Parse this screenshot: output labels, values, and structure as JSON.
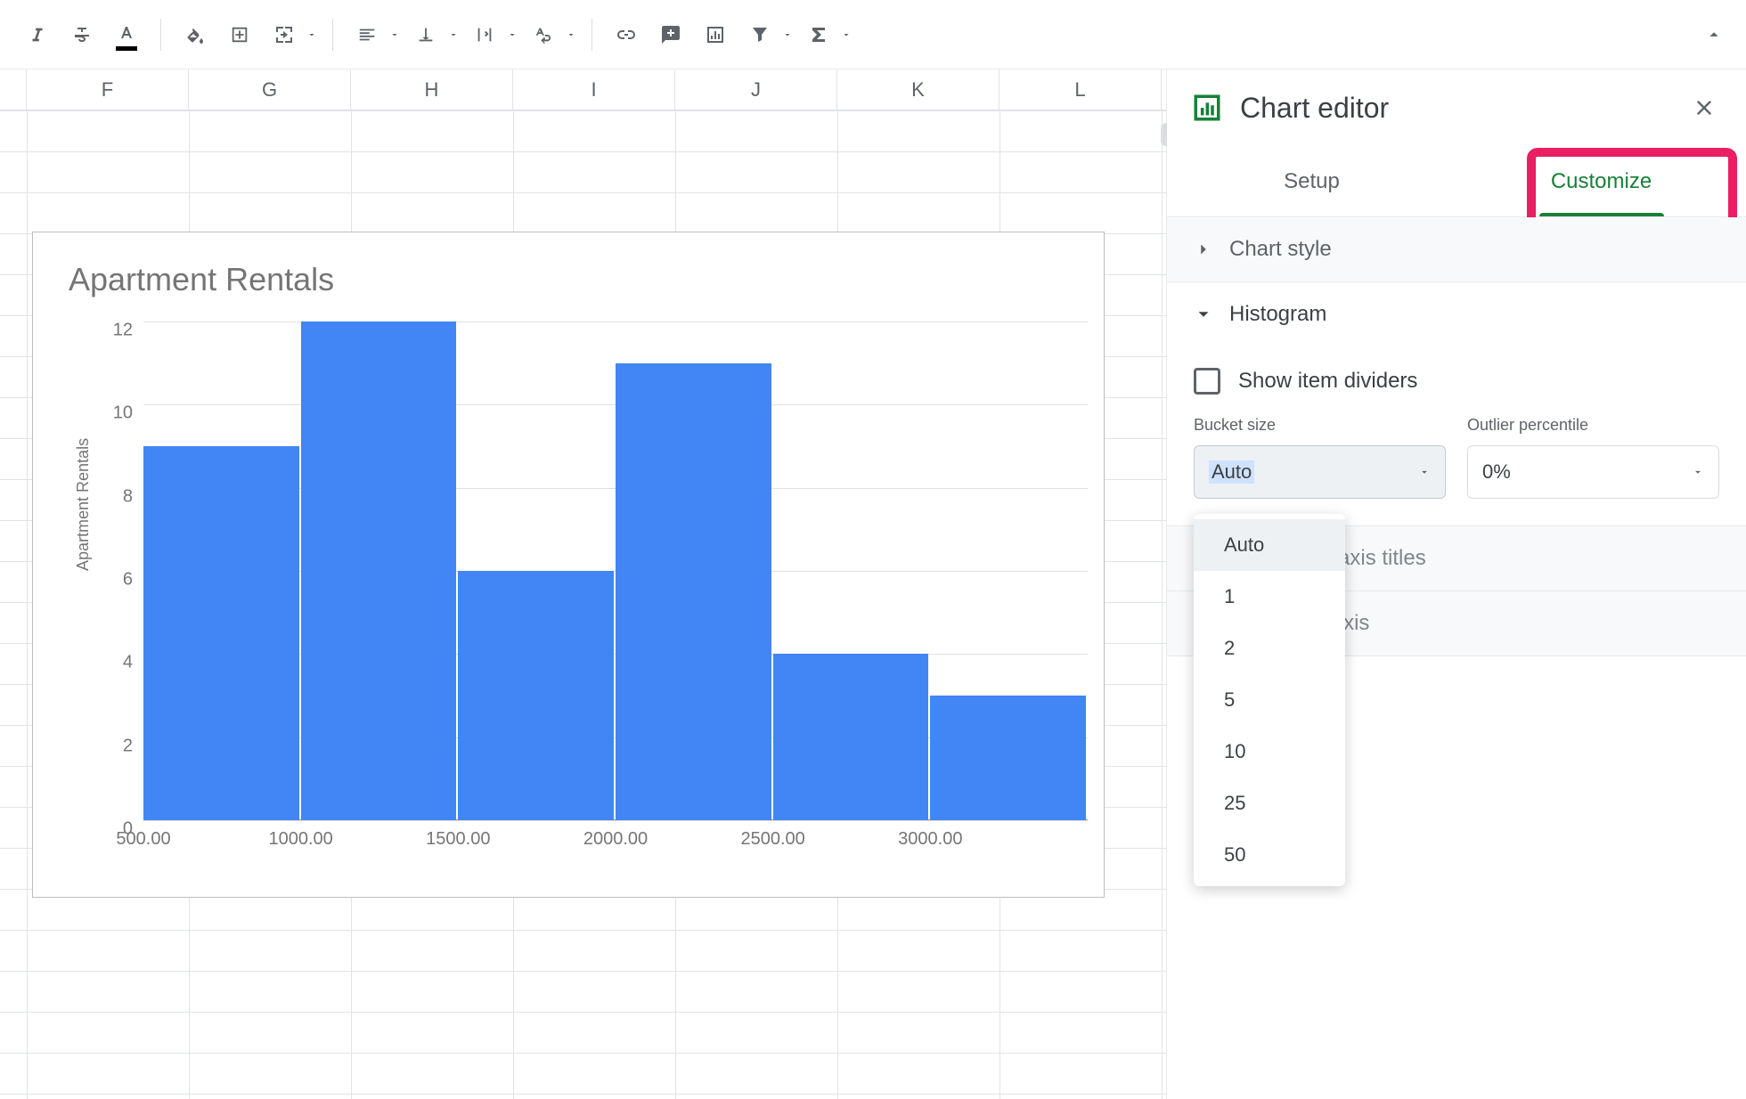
{
  "toolbar": {
    "buttons": [
      "italic",
      "strikethrough",
      "text-color",
      "|",
      "fill-color",
      "borders",
      "merge-cells",
      "merge-dropdown",
      "|",
      "h-align",
      "h-align-dropdown",
      "v-align",
      "v-align-dropdown",
      "wrap",
      "wrap-dropdown",
      "rotate",
      "rotate-dropdown",
      "|",
      "insert-link",
      "insert-comment",
      "insert-chart",
      "filter",
      "filter-dropdown",
      "functions",
      "functions-dropdown"
    ]
  },
  "columns": [
    "F",
    "G",
    "H",
    "I",
    "J",
    "K",
    "L"
  ],
  "chart_data": {
    "type": "bar",
    "title": "Apartment Rentals",
    "ylabel": "Apartment Rentals",
    "xlabel": "",
    "x_ticks": [
      "500.00",
      "1000.00",
      "1500.00",
      "2000.00",
      "2500.00",
      "3000.00"
    ],
    "y_ticks": [
      0,
      2,
      4,
      6,
      8,
      10,
      12
    ],
    "ylim": [
      0,
      12
    ],
    "categories": [
      "500–1000",
      "1000–1500",
      "1500–2000",
      "2000–2500",
      "2500–3000",
      "3000–3500"
    ],
    "values": [
      9,
      12,
      6,
      11,
      4,
      3
    ]
  },
  "panel": {
    "title": "Chart editor",
    "tabs": {
      "setup": "Setup",
      "customize": "Customize",
      "active": "customize"
    },
    "sections": {
      "chart_style": "Chart style",
      "histogram": "Histogram",
      "chart_axis_titles": "Chart & axis titles",
      "horizontal_axis": "Horizontal axis"
    },
    "histogram": {
      "show_dividers_label": "Show item dividers",
      "show_dividers_checked": false,
      "bucket_label": "Bucket size",
      "bucket_value": "Auto",
      "bucket_options": [
        "Auto",
        "1",
        "2",
        "5",
        "10",
        "25",
        "50"
      ],
      "outlier_label": "Outlier percentile",
      "outlier_value": "0%"
    }
  }
}
